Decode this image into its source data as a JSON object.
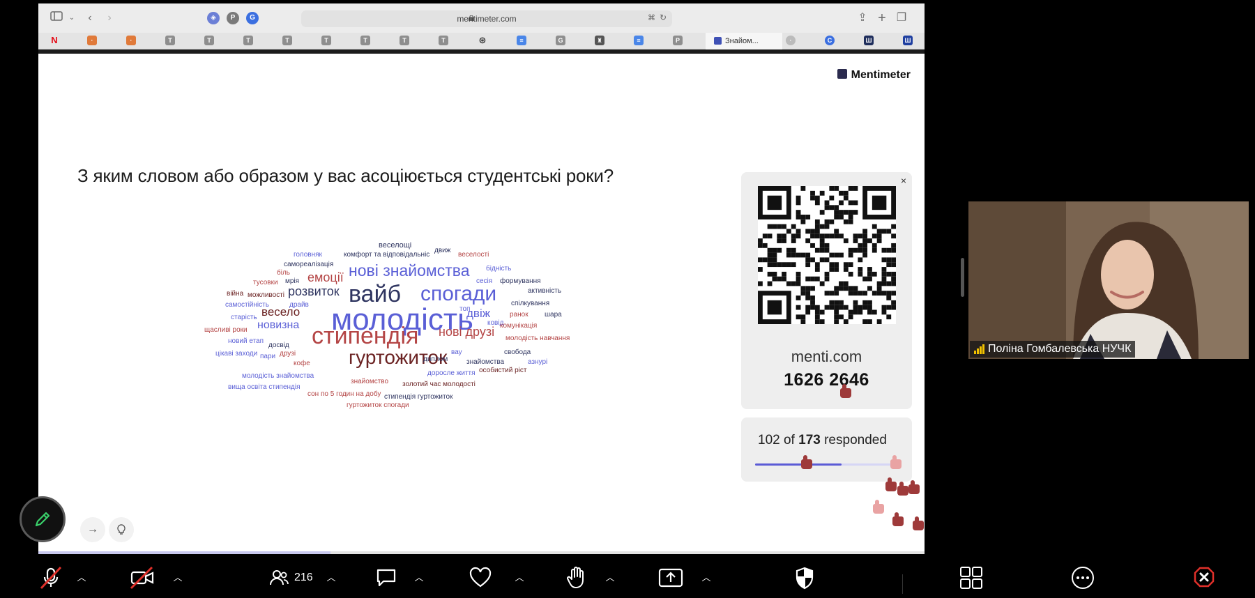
{
  "browser": {
    "url": "mentimeter.com",
    "active_tab_label": "Знайом..."
  },
  "slide": {
    "brand": "Mentimeter",
    "question": "З яким словом або образом у вас асоціюється студентські роки?",
    "join": {
      "site": "menti.com",
      "code": "1626 2646",
      "close_label": "×"
    },
    "responses": {
      "count": "102",
      "of_label": "of",
      "total": "173",
      "suffix": "responded",
      "fraction": 0.59
    },
    "slide_progress": 0.33
  },
  "word_cloud": [
    {
      "text": "молодість",
      "color": "#5a5fd6"
    },
    {
      "text": "стипендія",
      "color": "#b44545"
    },
    {
      "text": "вайб",
      "color": "#2f3560"
    },
    {
      "text": "спогади",
      "color": "#5a5fd6"
    },
    {
      "text": "нові знайомства",
      "color": "#5a5fd6"
    },
    {
      "text": "гуртожиток",
      "color": "#6b2323"
    },
    {
      "text": "розвиток",
      "color": "#2f3560"
    },
    {
      "text": "емоції",
      "color": "#b44545"
    },
    {
      "text": "весело",
      "color": "#6b2323"
    },
    {
      "text": "новизна",
      "color": "#5a5fd6"
    },
    {
      "text": "нові друзі",
      "color": "#b44545"
    },
    {
      "text": "двіж",
      "color": "#5a5fd6"
    },
    {
      "text": "веселощі",
      "color": "#2f3560"
    },
    {
      "text": "головняк",
      "color": "#5a5fd6"
    },
    {
      "text": "комфорт та відповідальніс",
      "color": "#2f3560"
    },
    {
      "text": "движ",
      "color": "#2f3560"
    },
    {
      "text": "веселості",
      "color": "#b44545"
    },
    {
      "text": "самореалізація",
      "color": "#2f3560"
    },
    {
      "text": "біль",
      "color": "#b44545"
    },
    {
      "text": "бідність",
      "color": "#5a5fd6"
    },
    {
      "text": "тусовки",
      "color": "#b44545"
    },
    {
      "text": "мрія",
      "color": "#2f3560"
    },
    {
      "text": "сесія",
      "color": "#5a5fd6"
    },
    {
      "text": "формування",
      "color": "#2f3560"
    },
    {
      "text": "війна",
      "color": "#6b2323"
    },
    {
      "text": "можливості",
      "color": "#6b2323"
    },
    {
      "text": "активність",
      "color": "#2f3560"
    },
    {
      "text": "самостійність",
      "color": "#5a5fd6"
    },
    {
      "text": "драйв",
      "color": "#5a5fd6"
    },
    {
      "text": "спілкування",
      "color": "#2f3560"
    },
    {
      "text": "топ",
      "color": "#5a5fd6"
    },
    {
      "text": "ранок",
      "color": "#b44545"
    },
    {
      "text": "шара",
      "color": "#2f3560"
    },
    {
      "text": "старість",
      "color": "#5a5fd6"
    },
    {
      "text": "ковід",
      "color": "#5a5fd6"
    },
    {
      "text": "комунікація",
      "color": "#b44545"
    },
    {
      "text": "щасливі роки",
      "color": "#b44545"
    },
    {
      "text": "молодість навчання",
      "color": "#b44545"
    },
    {
      "text": "новий етап",
      "color": "#5a5fd6"
    },
    {
      "text": "досвід",
      "color": "#2f3560"
    },
    {
      "text": "свобода",
      "color": "#2f3560"
    },
    {
      "text": "цікаві заходи",
      "color": "#5a5fd6"
    },
    {
      "text": "пари",
      "color": "#5a5fd6"
    },
    {
      "text": "друзі",
      "color": "#b44545"
    },
    {
      "text": "вау",
      "color": "#5a5fd6"
    },
    {
      "text": "диплом",
      "color": "#2f3560"
    },
    {
      "text": "знайомства",
      "color": "#2f3560"
    },
    {
      "text": "азнурі",
      "color": "#5a5fd6"
    },
    {
      "text": "кофе",
      "color": "#b44545"
    },
    {
      "text": "особистий ріст",
      "color": "#6b2323"
    },
    {
      "text": "доросле життя",
      "color": "#5a5fd6"
    },
    {
      "text": "молодість знайомства",
      "color": "#5a5fd6"
    },
    {
      "text": "знайомство",
      "color": "#b44545"
    },
    {
      "text": "вища освіта стипендія",
      "color": "#5a5fd6"
    },
    {
      "text": "золотий час молодості",
      "color": "#6b2323"
    },
    {
      "text": "сон по 5 годин на добу",
      "color": "#b44545"
    },
    {
      "text": "стипендія гуртожиток",
      "color": "#2f3560"
    },
    {
      "text": "гуртожиток спогади",
      "color": "#b44545"
    }
  ],
  "video": {
    "participant_name": "Поліна Гомбалевська НУЧК"
  },
  "zoom_toolbar": {
    "participants_count": "216"
  },
  "colors": {
    "accent": "#5b5bd6",
    "thumb_red": "#9e3a3a",
    "thumb_pink": "#e9a3a3",
    "pen_green": "#3ad16b"
  }
}
